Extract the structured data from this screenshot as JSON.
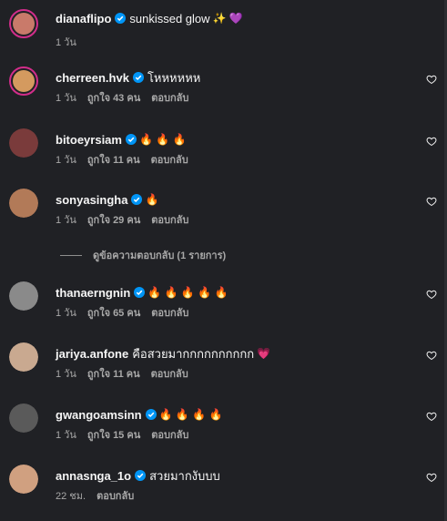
{
  "comments": [
    {
      "username": "dianaflipo",
      "text": "sunkissed glow",
      "emoji": "✨ 💜",
      "time": "1 วัน",
      "likes": "",
      "reply": "",
      "heart": false,
      "ring": true,
      "avatar_color": "#c97a6a",
      "text_font": "normal"
    },
    {
      "username": "cherreen.hvk",
      "text": "โหหหหหห",
      "emoji": "",
      "time": "1 วัน",
      "likes": "ถูกใจ 43 คน",
      "reply": "ตอบกลับ",
      "heart": true,
      "ring": true,
      "avatar_color": "#d49a5f",
      "text_font": "normal"
    },
    {
      "username": "bitoeyrsiam",
      "text": "",
      "emoji": "🔥 🔥 🔥",
      "time": "1 วัน",
      "likes": "ถูกใจ 11 คน",
      "reply": "ตอบกลับ",
      "heart": true,
      "ring": false,
      "avatar_color": "#7a3b3b",
      "text_font": "normal"
    },
    {
      "username": "sonyasingha",
      "text": "",
      "emoji": "🔥",
      "time": "1 วัน",
      "likes": "ถูกใจ 29 คน",
      "reply": "ตอบกลับ",
      "heart": true,
      "ring": false,
      "avatar_color": "#b27a58",
      "text_font": "normal"
    },
    {
      "username": "thanaerngnin",
      "text": "",
      "emoji": "🔥 🔥 🔥 🔥 🔥",
      "time": "1 วัน",
      "likes": "ถูกใจ 65 คน",
      "reply": "ตอบกลับ",
      "heart": true,
      "ring": false,
      "avatar_color": "#8a8a8a",
      "text_font": "normal"
    },
    {
      "username": "jariya.anfone",
      "text": "คือสวยมากกกกกกกกกก",
      "emoji": "💗",
      "time": "1 วัน",
      "likes": "ถูกใจ 11 คน",
      "reply": "ตอบกลับ",
      "heart": true,
      "ring": false,
      "avatar_color": "#c9a990",
      "text_font": "normal",
      "verified": false
    },
    {
      "username": "gwangoamsinn",
      "text": "",
      "emoji": "🔥 🔥 🔥 🔥",
      "time": "1 วัน",
      "likes": "ถูกใจ 15 คน",
      "reply": "ตอบกลับ",
      "heart": true,
      "ring": false,
      "avatar_color": "#5a5a5a",
      "text_font": "normal"
    },
    {
      "username": "annasnga_1o",
      "text": "สวยมากงับบบ",
      "emoji": "",
      "time": "22 ชม.",
      "likes": "",
      "reply": "ตอบกลับ",
      "heart": true,
      "ring": false,
      "avatar_color": "#d0a080",
      "text_font": "normal"
    }
  ],
  "view_replies": "ดูข้อความตอบกลับ (1 รายการ)",
  "colors": {
    "background": "#202125",
    "verified": "#0095f6",
    "muted": "#a8a8a8"
  }
}
